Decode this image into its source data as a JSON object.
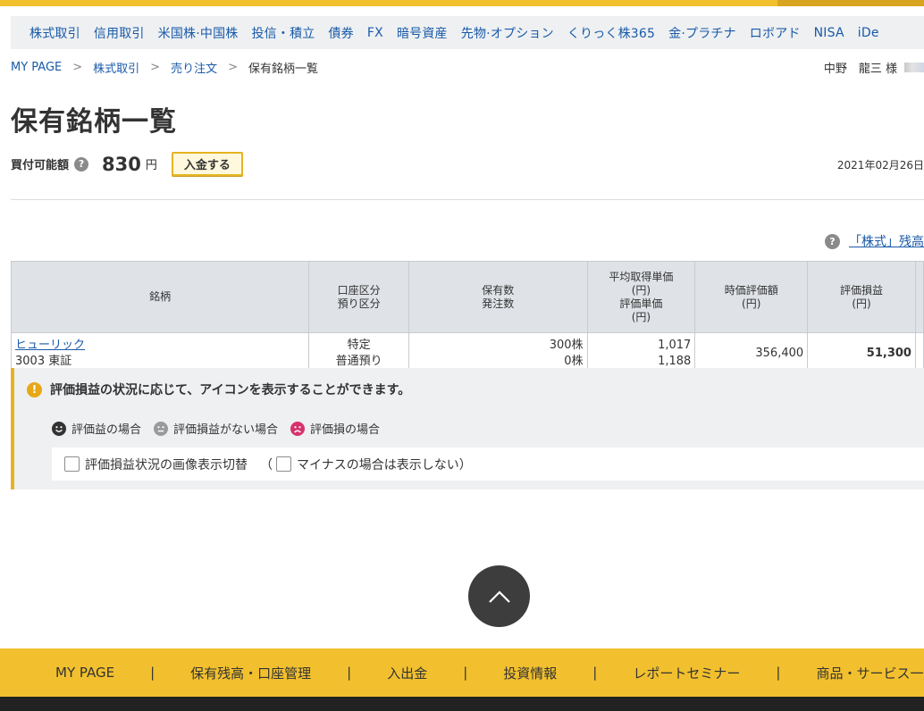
{
  "global_nav": [
    "株式取引",
    "信用取引",
    "米国株·中国株",
    "投信・積立",
    "債券",
    "FX",
    "暗号資産",
    "先物·オプション",
    "くりっく株365",
    "金·プラチナ",
    "ロボアド",
    "NISA",
    "iDe"
  ],
  "breadcrumb": {
    "items": [
      "MY PAGE",
      "株式取引",
      "売り注文"
    ],
    "current": "保有銘柄一覧",
    "separator": ">"
  },
  "user": {
    "name": "中野　龍三 様"
  },
  "page_title": "保有銘柄一覧",
  "buying_power": {
    "label": "買付可能額",
    "amount": "830",
    "unit": "円",
    "deposit_button": "入金する"
  },
  "date": "2021年02月26日",
  "help_link": {
    "text": "「株式」残高"
  },
  "table": {
    "headers": {
      "stock": [
        "銘柄"
      ],
      "account": [
        "口座区分",
        "預り区分"
      ],
      "quantity": [
        "保有数",
        "発注数"
      ],
      "price": [
        "平均取得単価",
        "(円)",
        "評価単価",
        "(円)"
      ],
      "market_value": [
        "時価評価額",
        "(円)"
      ],
      "pl": [
        "評価損益",
        "(円)"
      ]
    },
    "rows": [
      {
        "name": "ヒューリック",
        "code_market": "3003 東証",
        "account_type": "特定",
        "custody_type": "普通預り",
        "holding": "300株",
        "order": "0株",
        "avg_cost": "1,017",
        "eval_price": "1,188",
        "market_value": "356,400",
        "pl": "51,300"
      }
    ]
  },
  "info_panel": {
    "heading": "評価損益の状況に応じて、アイコンを表示することができます。",
    "legend": {
      "profit": "評価益の場合",
      "even": "評価損益がない場合",
      "loss": "評価損の場合"
    },
    "toggle_label": "評価損益状況の画像表示切替",
    "paren_open": "（",
    "minus_label": "マイナスの場合は表示しない）",
    "colors": {
      "profit": "#333333",
      "even": "#9a9a9a",
      "loss": "#d6336c"
    }
  },
  "footer_nav": [
    "MY PAGE",
    "保有残高・口座管理",
    "入出金",
    "投資情報",
    "レポートセミナー",
    "商品・サービス一"
  ],
  "icons": {
    "help": "question-circle-icon",
    "info": "info-circle-icon",
    "to_top": "chevron-up-icon"
  }
}
